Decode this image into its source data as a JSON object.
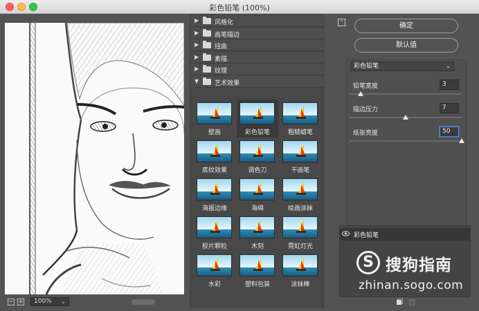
{
  "window": {
    "title": "彩色铅笔 (100%)"
  },
  "preview": {
    "zoom": "100%",
    "zoom_out": "−",
    "zoom_in": "+",
    "caret": "⌄"
  },
  "gallery": {
    "categories": [
      {
        "label": "风格化",
        "arrow": "▶"
      },
      {
        "label": "画笔描边",
        "arrow": "▶"
      },
      {
        "label": "扭曲",
        "arrow": "▶"
      },
      {
        "label": "素描",
        "arrow": "▶"
      },
      {
        "label": "纹理",
        "arrow": "▶"
      },
      {
        "label": "艺术效果",
        "arrow": "▼"
      }
    ],
    "filters": [
      "壁画",
      "彩色铅笔",
      "粗糙蜡笔",
      "底纹效果",
      "调色刀",
      "干画笔",
      "海报边缘",
      "海绵",
      "绘画涂抹",
      "胶片颗粒",
      "木刻",
      "霓虹灯光",
      "水彩",
      "塑料包装",
      "涂抹棒"
    ],
    "selected_index": 1
  },
  "panel": {
    "ok_label": "确定",
    "default_label": "默认值",
    "collapse_icon": "⌃",
    "filter_select": "彩色铅笔",
    "filter_select_caret": "⌄",
    "params": [
      {
        "label": "铅笔宽度",
        "value": "3",
        "fraction": 0.1
      },
      {
        "label": "描边压力",
        "value": "7",
        "fraction": 0.5
      },
      {
        "label": "纸张亮度",
        "value": "50",
        "fraction": 1.0
      }
    ]
  },
  "layers": [
    {
      "name": "彩色铅笔"
    }
  ],
  "watermark": {
    "logo": "S",
    "brand": "搜狗指南",
    "url": "zhinan.sogo.com"
  }
}
